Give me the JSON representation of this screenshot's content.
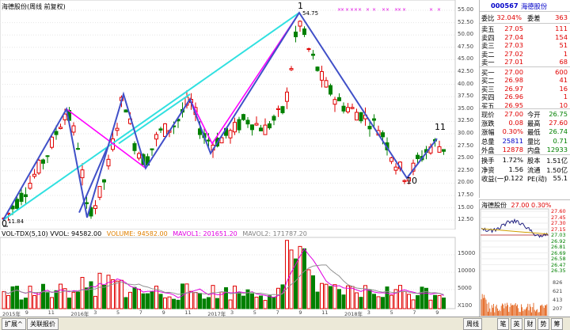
{
  "main_title": "海德股份(周线 前复权)",
  "vol_title": {
    "prefix": "VOL-TDX(5,10) VVOL: 94582.00",
    "volume": "VOLUME: 94582.00",
    "mavol1": "MAVOL1: 201651.20",
    "mavol2": "MAVOL2: 171787.20"
  },
  "price_axis": [
    "55.00",
    "52.50",
    "50.00",
    "47.50",
    "45.00",
    "42.50",
    "40.00",
    "37.50",
    "35.00",
    "32.50",
    "30.00",
    "27.50",
    "25.00",
    "22.50",
    "20.00",
    "17.50",
    "15.00",
    "12.50"
  ],
  "vol_axis": [
    "15000",
    "10000",
    "5000",
    "X100"
  ],
  "high_label": "54.75",
  "low_label": "11.84",
  "wave_labels": {
    "start": "0",
    "peak": "1",
    "low": "10",
    "last": "11"
  },
  "date_labels": [
    "2015年",
    "9",
    "11",
    "2016年",
    "3",
    "5",
    "7",
    "9",
    "11",
    "2017年",
    "3",
    "5",
    "7",
    "9",
    "11",
    "2018年",
    "3",
    "5",
    "7",
    "9"
  ],
  "quote": {
    "code": "000567",
    "name": "海德股份",
    "row_commission": {
      "label1": "委比",
      "value1": "32.04%",
      "label2": "委差",
      "value2": "363"
    },
    "asks": [
      {
        "label": "卖五",
        "price": "27.05",
        "vol": "111"
      },
      {
        "label": "卖四",
        "price": "27.04",
        "vol": "154"
      },
      {
        "label": "卖三",
        "price": "27.03",
        "vol": "51"
      },
      {
        "label": "卖二",
        "price": "27.02",
        "vol": "1"
      },
      {
        "label": "卖一",
        "price": "27.01",
        "vol": "68"
      }
    ],
    "bids": [
      {
        "label": "买一",
        "price": "27.00",
        "vol": "600"
      },
      {
        "label": "买二",
        "price": "26.98",
        "vol": "41"
      },
      {
        "label": "买三",
        "price": "26.97",
        "vol": "16"
      },
      {
        "label": "买四",
        "price": "26.96",
        "vol": "1"
      },
      {
        "label": "买五",
        "price": "26.95",
        "vol": "10"
      }
    ],
    "stats": [
      {
        "l1": "现价",
        "v1": "27.00",
        "c1": "red",
        "l2": "今开",
        "v2": "26.75",
        "c2": "green"
      },
      {
        "l1": "涨跌",
        "v1": "0.08",
        "c1": "red",
        "l2": "最高",
        "v2": "27.60",
        "c2": "red"
      },
      {
        "l1": "涨幅",
        "v1": "0.30%",
        "c1": "red",
        "l2": "最低",
        "v2": "26.74",
        "c2": "green"
      },
      {
        "l1": "总量",
        "v1": "25811",
        "c1": "blue",
        "l2": "量比",
        "v2": "0.71",
        "c2": "green"
      },
      {
        "l1": "外盘",
        "v1": "12878",
        "c1": "red",
        "l2": "内盘",
        "v2": "12933",
        "c2": "green"
      }
    ],
    "stats2": [
      {
        "l1": "换手",
        "v1": "1.72%",
        "l2": "股本",
        "v2": "1.51亿"
      },
      {
        "l1": "净资",
        "v1": "1.56",
        "l2": "流通",
        "v2": "1.50亿"
      },
      {
        "l1": "收益(一)",
        "v1": "0.122",
        "l2": "PE(动)",
        "v2": "55.1"
      }
    ]
  },
  "mini": {
    "header_name": "海德股份",
    "header_price": "27.00 0.30%",
    "price_ticks": [
      "27.60",
      "27.45",
      "27.30",
      "27.15",
      "27.03",
      "26.92",
      "26.81",
      "26.69",
      "26.58",
      "26.47",
      "26.35"
    ],
    "vol_ticks": [
      "826",
      "621",
      "413",
      "207"
    ]
  },
  "tabs": {
    "expand": "扩展^",
    "related": "关联报价",
    "period": "周线"
  },
  "mini_tabs": [
    "笔",
    "英",
    "财",
    "势",
    "筹"
  ],
  "colors": {
    "up": "#e00000",
    "down": "#008000",
    "cyan": "#30e0e0",
    "magenta": "#ff00ff",
    "blue_wave": "#4050c8"
  }
}
